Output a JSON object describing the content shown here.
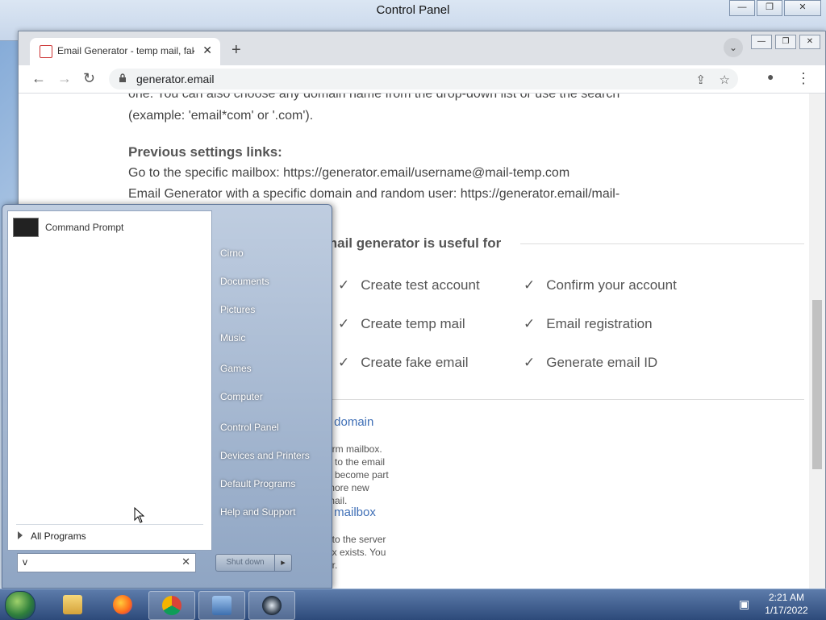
{
  "control_panel": {
    "title": "Control Panel",
    "minimize": "—",
    "maximize": "❐",
    "close": "✕"
  },
  "browser": {
    "tab_title": "Email Generator - temp mail, fake",
    "tab_close": "✕",
    "new_tab": "+",
    "tab_search": "⌄",
    "url": "generator.email",
    "back": "←",
    "forward": "→",
    "reload": "↻",
    "share": "⇪",
    "bookmark": "☆",
    "profile": "●",
    "menu": "⋮",
    "win_min": "—",
    "win_max": "❐",
    "win_close": "✕"
  },
  "page": {
    "intro_line1": "one. You can also choose any domain name from the drop-down list or use the search",
    "intro_line2": "(example: 'email*com' or '.com').",
    "prev_heading": "Previous settings links:",
    "prev_line1": "Go to the specific mailbox: https://generator.email/username@mail-temp.com",
    "prev_line2": "Email Generator with a specific domain and random user: https://generator.email/mail-",
    "useful_heading": "mail generator is useful for",
    "features": [
      "Create test account",
      "Confirm your account",
      "Create temp mail",
      "Email registration",
      "Create fake email",
      "Generate email ID"
    ],
    "check": "✓",
    "link1": "r domain",
    "text1": [
      "erm mailbox.",
      "n to the email",
      "o become part",
      "more new",
      "mail."
    ],
    "link2": "r mailbox",
    "text2": [
      "t to the server",
      "ox exists. You",
      "er."
    ]
  },
  "start_menu": {
    "pinned": [
      {
        "label": "Command Prompt"
      }
    ],
    "all_programs": "All Programs",
    "search_value": "v",
    "search_clear": "✕",
    "right_items": [
      "Cirno",
      "Documents",
      "Pictures",
      "Music",
      "Games",
      "Computer",
      "Control Panel",
      "Devices and Printers",
      "Default Programs",
      "Help and Support"
    ],
    "shutdown": "Shut down",
    "shutdown_arrow": "▸"
  },
  "taskbar": {
    "time": "2:21 AM",
    "date": "1/17/2022"
  }
}
